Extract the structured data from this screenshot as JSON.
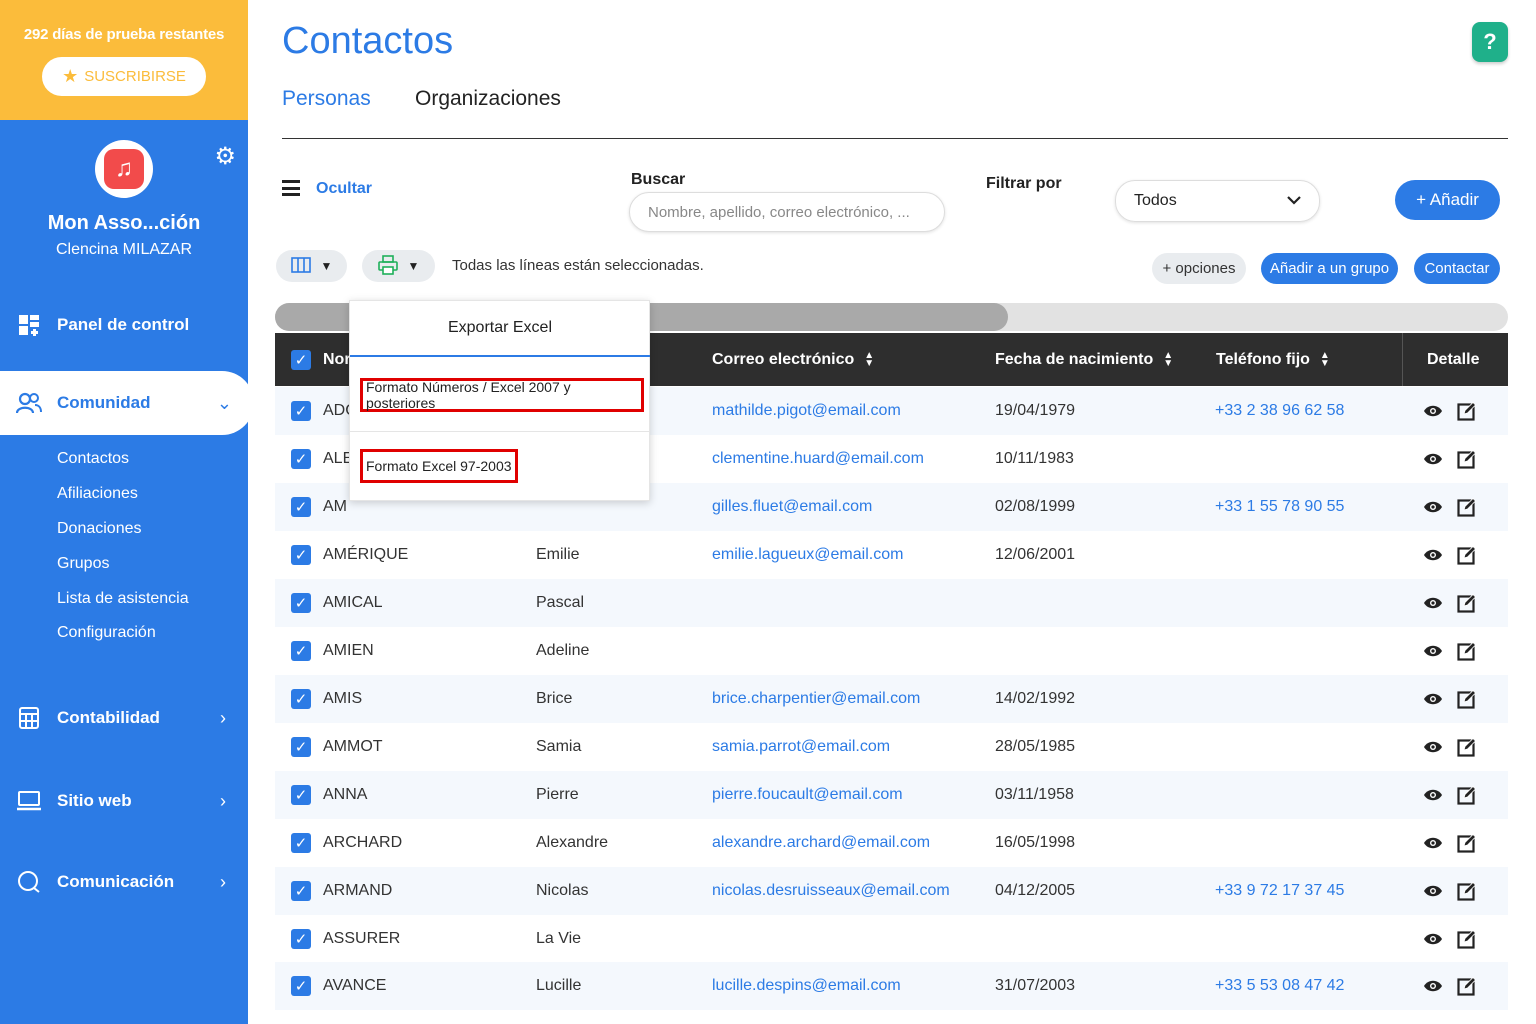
{
  "sidebar": {
    "trial_text": "292 días de prueba restantes",
    "subscribe_label": "SUSCRIBIRSE",
    "org_name": "Mon Asso...ción",
    "user_name": "Clencina MILAZAR",
    "nav": {
      "panel": "Panel de control",
      "comunidad": "Comunidad",
      "contabilidad": "Contabilidad",
      "sitio_web": "Sitio web",
      "comunicacion": "Comunicación"
    },
    "sub_items": [
      "Contactos",
      "Afiliaciones",
      "Donaciones",
      "Grupos",
      "Lista de asistencia",
      "Configuración"
    ]
  },
  "header": {
    "title": "Contactos",
    "help": "?",
    "tabs": [
      "Personas",
      "Organizaciones"
    ]
  },
  "toolbar": {
    "hide_label": "Ocultar",
    "search_label": "Buscar",
    "search_placeholder": "Nombre, apellido, correo electrónico, ...",
    "filter_label": "Filtrar por",
    "filter_value": "Todos",
    "add_label": "+ Añadir",
    "selection_text": "Todas las líneas están seleccionadas.",
    "options_label": "+ opciones",
    "add_group_label": "Añadir a un grupo",
    "contact_label": "Contactar"
  },
  "export_menu": {
    "title": "Exportar Excel",
    "options": [
      "Formato Números / Excel 2007 y posteriores",
      "Formato Excel 97-2003"
    ]
  },
  "table": {
    "headers": {
      "name": "Nor",
      "email": "Correo electrónico",
      "birth": "Fecha de nacimiento",
      "phone": "Teléfono fijo",
      "detail": "Detalle"
    },
    "rows": [
      {
        "name": "ADC",
        "first": "",
        "email": "mathilde.pigot@email.com",
        "birth": "19/04/1979",
        "phone": "+33 2 38 96 62 58"
      },
      {
        "name": "ALE",
        "first": "",
        "email": "clementine.huard@email.com",
        "birth": "10/11/1983",
        "phone": ""
      },
      {
        "name": "AM",
        "first": "",
        "email": "gilles.fluet@email.com",
        "birth": "02/08/1999",
        "phone": "+33 1 55 78 90 55"
      },
      {
        "name": "AMÉRIQUE",
        "first": "Emilie",
        "email": "emilie.lagueux@email.com",
        "birth": "12/06/2001",
        "phone": ""
      },
      {
        "name": "AMICAL",
        "first": "Pascal",
        "email": "",
        "birth": "",
        "phone": ""
      },
      {
        "name": "AMIEN",
        "first": "Adeline",
        "email": "",
        "birth": "",
        "phone": ""
      },
      {
        "name": "AMIS",
        "first": "Brice",
        "email": "brice.charpentier@email.com",
        "birth": "14/02/1992",
        "phone": ""
      },
      {
        "name": "AMMOT",
        "first": "Samia",
        "email": "samia.parrot@email.com",
        "birth": "28/05/1985",
        "phone": ""
      },
      {
        "name": "ANNA",
        "first": "Pierre",
        "email": "pierre.foucault@email.com",
        "birth": "03/11/1958",
        "phone": ""
      },
      {
        "name": "ARCHARD",
        "first": "Alexandre",
        "email": "alexandre.archard@email.com",
        "birth": "16/05/1998",
        "phone": ""
      },
      {
        "name": "ARMAND",
        "first": "Nicolas",
        "email": "nicolas.desruisseaux@email.com",
        "birth": "04/12/2005",
        "phone": "+33 9 72 17 37 45"
      },
      {
        "name": "ASSURER",
        "first": "La Vie",
        "email": "",
        "birth": "",
        "phone": ""
      },
      {
        "name": "AVANCE",
        "first": "Lucille",
        "email": "lucille.despins@email.com",
        "birth": "31/07/2003",
        "phone": "+33 5 53 08 47 42"
      }
    ]
  },
  "colors": {
    "brand": "#2c7be5",
    "trial": "#fbbc3b",
    "header_dark": "#2e2e2e",
    "highlight": "#e00000",
    "help": "#1fb08a"
  },
  "icons": [
    "star-icon",
    "music-note-icon",
    "gear-icon",
    "dashboard-icon",
    "users-icon",
    "calculator-icon",
    "monitor-icon",
    "chat-icon",
    "columns-icon",
    "printer-icon",
    "eye-icon",
    "edit-icon",
    "checkbox-icon",
    "chevron-down-icon",
    "chevron-right-icon",
    "sort-icon"
  ]
}
